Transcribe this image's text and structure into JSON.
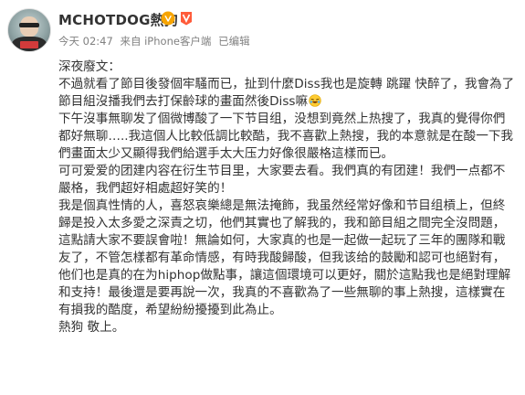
{
  "user": {
    "name": "MCHOTDOG熱狗",
    "avatar_icon": "user-avatar",
    "verified_icon": "verified-v-badge",
    "member_icon": "vip-member-badge",
    "brand_color": "#f7a400",
    "verified_color": "#f7a400"
  },
  "meta": {
    "time": "今天 02:47",
    "source": "来自 iPhone客户端",
    "edited": "已编辑"
  },
  "post": {
    "p1": "深夜廢文：",
    "p2": "不過就看了節目後發個牢騷而已，扯到什麼Diss我也是旋轉 跳躍 快醉了，我會為了節目組沒播我們去打保齡球的畫面然後Diss嘛",
    "p3": "下午沒事無聊发了個微博酸了一下节目组，没想到竟然上热搜了，我真的覺得你們都好無聊…..我這個人比較低調比較酷，我不喜歡上熱搜，我的本意就是在酸一下我們畫面太少又顯得我們給選手太大压力好像很嚴格這樣而已。",
    "p4": "可可爱爱的团建内容在衍生节目里，大家要去看。我們真的有团建！我們一点都不嚴格，我們超好相處超好笑的！",
    "p5": "我是個真性情的人，喜怒哀樂總是無法掩飾，我虽然经常好像和节目组槓上，但終歸是投入太多愛之深責之切，他們其實也了解我的，我和節目組之間完全沒問題，這點請大家不要誤會啦！無論如何，大家真的也是一起做一起玩了三年的團隊和戰友了，不管怎樣都有革命情感，有時我酸歸酸，但我该给的鼓勵和認可也絕對有，他们也是真的在为hiphop做點事，讓這個環境可以更好，關於這點我也是絕對理解和支持！最後還是要再說一次，我真的不喜歡為了一些無聊的事上熱搜，這樣實在有損我的酷度，希望紛紛擾擾到此為止。",
    "p6": "熱狗 敬上。",
    "emoji_icon": "laughing-crying-emoji"
  }
}
